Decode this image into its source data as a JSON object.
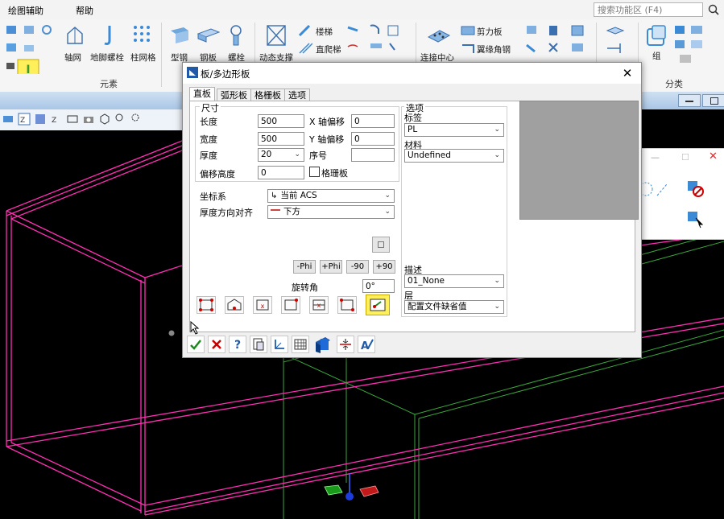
{
  "menubar": {
    "items": [
      "绘图辅助",
      "帮助"
    ],
    "search_placeholder": "搜索功能区 (F4)"
  },
  "ribbon": {
    "buttons": {
      "axis_grid": "轴网",
      "anchor_bolt": "地脚螺栓",
      "column_grid": "柱网格",
      "section_steel": "型钢",
      "steel_plate": "钢板",
      "bolt": "螺栓",
      "dynamic_brace": "动态支撑",
      "stair": "楼梯",
      "straight_ladder": "直爬梯",
      "connection_center": "连接中心",
      "shear_plate": "剪力板",
      "flange_angle": "翼缘角钢",
      "group": "组"
    },
    "groups": {
      "elements": "元素",
      "classify": "分类"
    }
  },
  "dialog": {
    "title": "板/多边形板",
    "tabs": [
      "直板",
      "弧形板",
      "格栅板",
      "选项"
    ],
    "dimensions": {
      "legend": "尺寸",
      "length_label": "长度",
      "length_value": "500",
      "width_label": "宽度",
      "width_value": "500",
      "thickness_label": "厚度",
      "thickness_value": "20",
      "offset_height_label": "偏移高度",
      "offset_height_value": "0",
      "x_offset_label": "X 轴偏移",
      "x_offset_value": "0",
      "y_offset_label": "Y 轴偏移",
      "y_offset_value": "0",
      "seq_label": "序号",
      "seq_value": "",
      "grating_label": "格珊板"
    },
    "coord_label": "坐标系",
    "coord_value": "当前 ACS",
    "align_label": "厚度方向对齐",
    "align_value": "下方",
    "rotate_buttons": [
      "-Phi",
      "+Phi",
      "-90",
      "+90"
    ],
    "rotation_label": "旋转角",
    "rotation_value": "0°",
    "options": {
      "legend": "选项",
      "tag_label": "标签",
      "tag_value": "PL",
      "material_label": "材料",
      "material_value": "Undefined",
      "desc_label": "描述",
      "desc_value": "01_None",
      "layer_label": "层",
      "layer_value": "配置文件缺省值"
    }
  },
  "colors": {
    "wire_pink": "#ff2fb4",
    "wire_green": "#3aa63a",
    "highlight": "#ffef5a",
    "preview": "#a0a0a0"
  }
}
